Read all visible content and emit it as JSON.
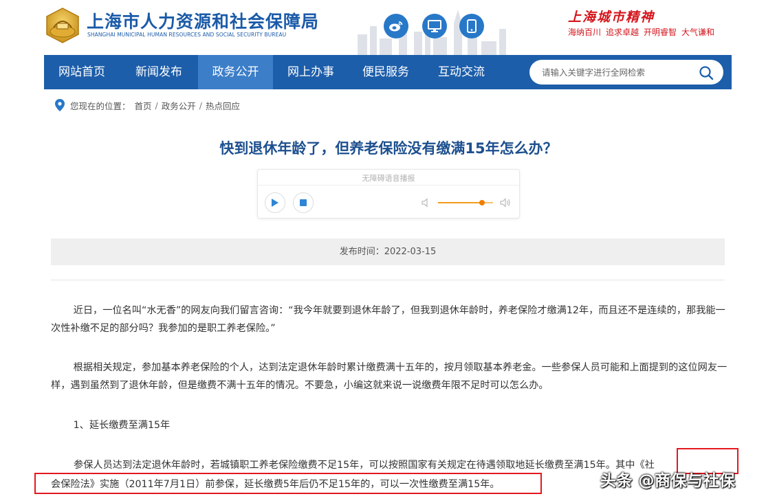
{
  "header": {
    "title_cn": "上海市人力资源和社会保障局",
    "title_en": "SHANGHAI MUNICIPAL HUMAN RESOURCES AND SOCIAL SECURITY BUREAU",
    "social_icons": [
      "weibo-icon",
      "desktop-icon",
      "mobile-icon"
    ],
    "city_spirit": {
      "title": "上海城市精神",
      "words": [
        "海纳百川",
        "追求卓越",
        "开明睿智",
        "大气谦和"
      ]
    },
    "colors": {
      "brand_blue": "#1a5aa8",
      "spirit_red": "#d4141b"
    }
  },
  "nav": {
    "items": [
      {
        "label": "网站首页",
        "active": false
      },
      {
        "label": "新闻发布",
        "active": false
      },
      {
        "label": "政务公开",
        "active": true
      },
      {
        "label": "网上办事",
        "active": false
      },
      {
        "label": "便民服务",
        "active": false
      },
      {
        "label": "互动交流",
        "active": false
      }
    ],
    "search_placeholder": "请输入关键字进行全网检索",
    "colors": {
      "bar": "#1d5eaa",
      "active": "#3c7ec8"
    }
  },
  "breadcrumb": {
    "label": "您现在的位置：",
    "items": [
      "首页",
      "政务公开",
      "热点回应"
    ],
    "separator": "/"
  },
  "article": {
    "title": "快到退休年龄了，但养老保险没有缴满15年怎么办？",
    "player": {
      "label": "无障碍语音播报",
      "volume": 0.8
    },
    "publish_time": "发布时间：2022-03-15",
    "paragraphs": [
      "近日，一位名叫“水无香”的网友向我们留言咨询：“我今年就要到退休年龄了，但我到退休年龄时，养老保险才缴满12年，而且还不是连续的，那我能一次性补缴不足的部分吗？我参加的是职工养老保险。”",
      "根据相关规定，参加基本养老保险的个人，达到法定退休年龄时累计缴费满十五年的，按月领取基本养老金。一些参保人员可能和上面提到的这位网友一样，遇到虽然到了退休年龄，但是缴费不满十五年的情况。不要急，小编这就来说一说缴费年限不足时可以怎么办。",
      "1、延长缴费至满15年"
    ],
    "last_para": {
      "line1_plain": "参保人员达到法定退休年龄时，若城镇职工养老保险缴费不足15年，可以按照国家有关规定在待遇领取地延长缴费至满15年。",
      "line1_boxed": "其中《社",
      "line2_boxed": "会保险法》实施（2011年7月1日）前参保，延长缴费5年后仍不足15年的，可以一次性缴费至满15年。"
    }
  },
  "watermark": "头条 @商保与社保"
}
